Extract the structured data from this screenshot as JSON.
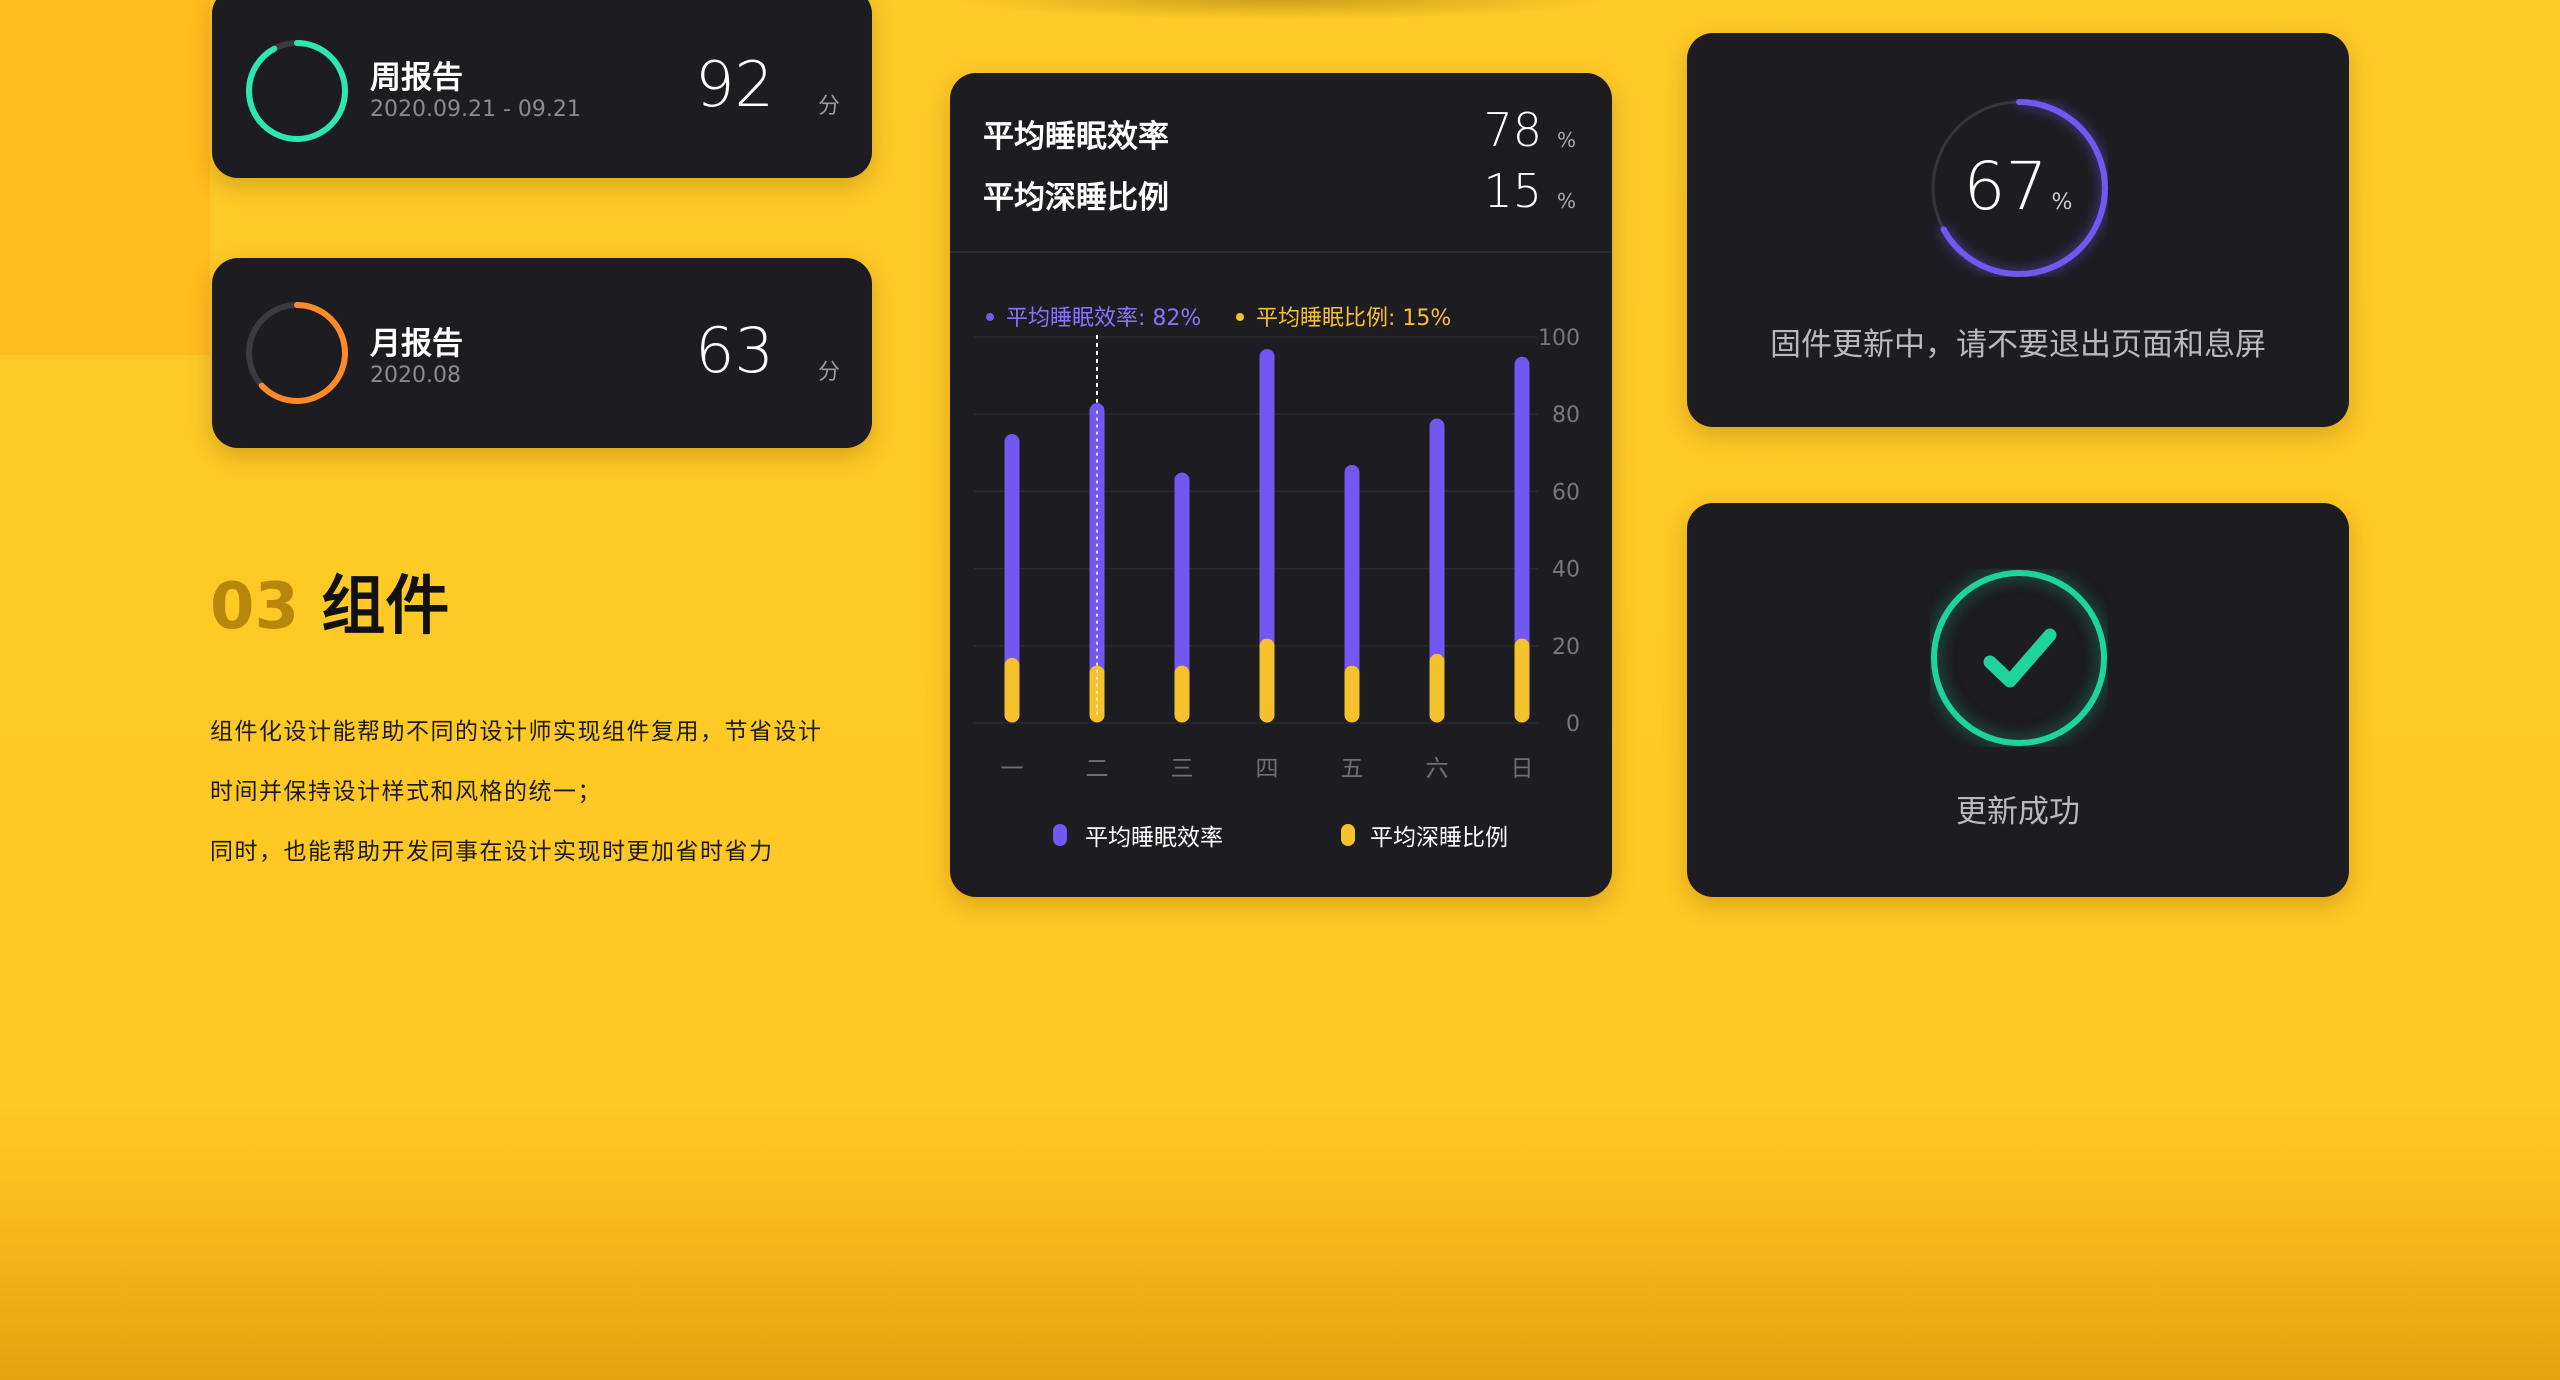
{
  "reports": {
    "weekly": {
      "title": "周报告",
      "date": "2020.09.21 - 09.21",
      "score": "92",
      "unit": "分",
      "ring_color": "#2ee6b0",
      "progress": 0.92
    },
    "monthly": {
      "title": "月报告",
      "date": "2020.08",
      "score": "63",
      "unit": "分",
      "ring_color": "#ff8a2a",
      "progress": 0.63
    }
  },
  "section": {
    "number": "03",
    "title": "组件",
    "lines": [
      "组件化设计能帮助不同的设计师实现组件复用，节省设计",
      "时间并保持设计样式和风格的统一；",
      "同时，也能帮助开发同事在设计实现时更加省时省力"
    ]
  },
  "sleep_card": {
    "efficiency_label": "平均睡眠效率",
    "efficiency_value": "78",
    "deep_label": "平均深睡比例",
    "deep_value": "15",
    "unit": "%",
    "tooltip_efficiency": "平均睡眠效率: 82%",
    "tooltip_deep": "平均睡眠比例: 15%",
    "legend_efficiency": "平均睡眠效率",
    "legend_deep": "平均深睡比例"
  },
  "chart_data": {
    "type": "bar",
    "categories": [
      "一",
      "二",
      "三",
      "四",
      "五",
      "六",
      "日"
    ],
    "series": [
      {
        "name": "平均睡眠效率",
        "color": "#7257f0",
        "values": [
          75,
          83,
          65,
          97,
          67,
          79,
          95
        ]
      },
      {
        "name": "平均深睡比例",
        "color": "#f5c22e",
        "values": [
          17,
          15,
          15,
          22,
          15,
          18,
          22
        ]
      }
    ],
    "y_ticks": [
      0,
      20,
      40,
      60,
      80,
      100
    ],
    "ylim": [
      0,
      100
    ],
    "highlight_index": 1,
    "grid": true
  },
  "firmware": {
    "percent": "67",
    "unit": "%",
    "message": "固件更新中，请不要退出页面和息屏",
    "progress": 0.67,
    "ring_color": "#7257f0"
  },
  "success": {
    "message": "更新成功",
    "color": "#1fd39c"
  }
}
